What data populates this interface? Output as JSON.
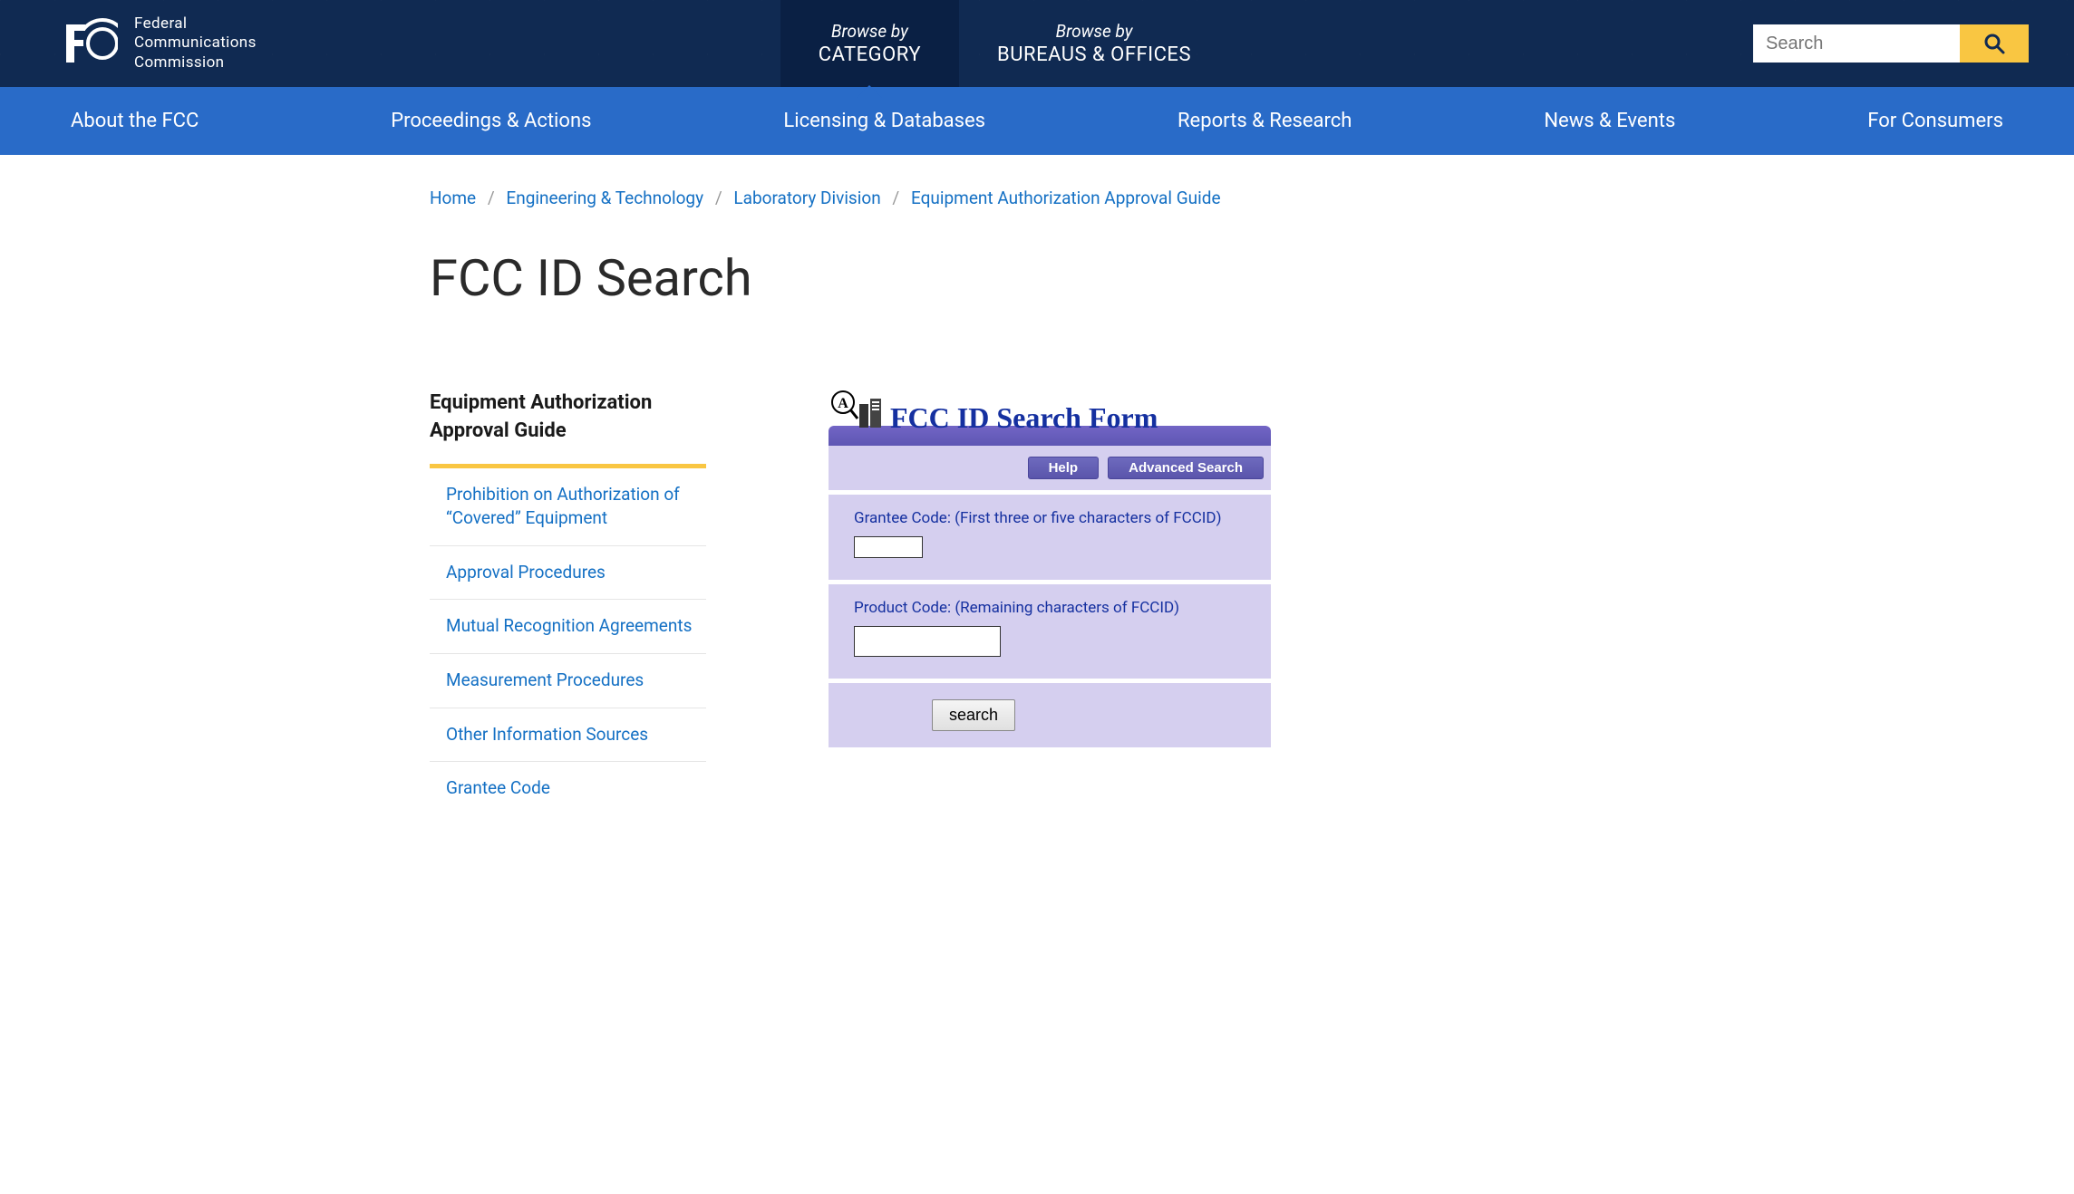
{
  "header": {
    "org_line1": "Federal",
    "org_line2": "Communications",
    "org_line3": "Commission",
    "browse_label": "Browse by",
    "browse_category": "CATEGORY",
    "browse_bureaus": "BUREAUS & OFFICES",
    "search_placeholder": "Search"
  },
  "nav": {
    "about": "About the FCC",
    "proceedings": "Proceedings & Actions",
    "licensing": "Licensing & Databases",
    "reports": "Reports & Research",
    "news": "News & Events",
    "consumers": "For Consumers"
  },
  "breadcrumb": {
    "home": "Home",
    "eng": "Engineering & Technology",
    "lab": "Laboratory Division",
    "guide": "Equipment Authorization Approval Guide"
  },
  "page_title": "FCC ID Search",
  "sidebar": {
    "header": "Equipment Authorization Approval Guide",
    "items": [
      "Prohibition on Authorization of “Covered” Equipment",
      "Approval Procedures",
      "Mutual Recognition Agreements",
      "Measurement Procedures",
      "Other Information Sources",
      "Grantee Code"
    ]
  },
  "form": {
    "title": "FCC ID Search Form",
    "help": "Help",
    "advanced": "Advanced Search",
    "grantee_label": "Grantee Code: (First three or five characters of FCCID)",
    "product_label": "Product Code: (Remaining characters of FCCID)",
    "submit": "search"
  }
}
